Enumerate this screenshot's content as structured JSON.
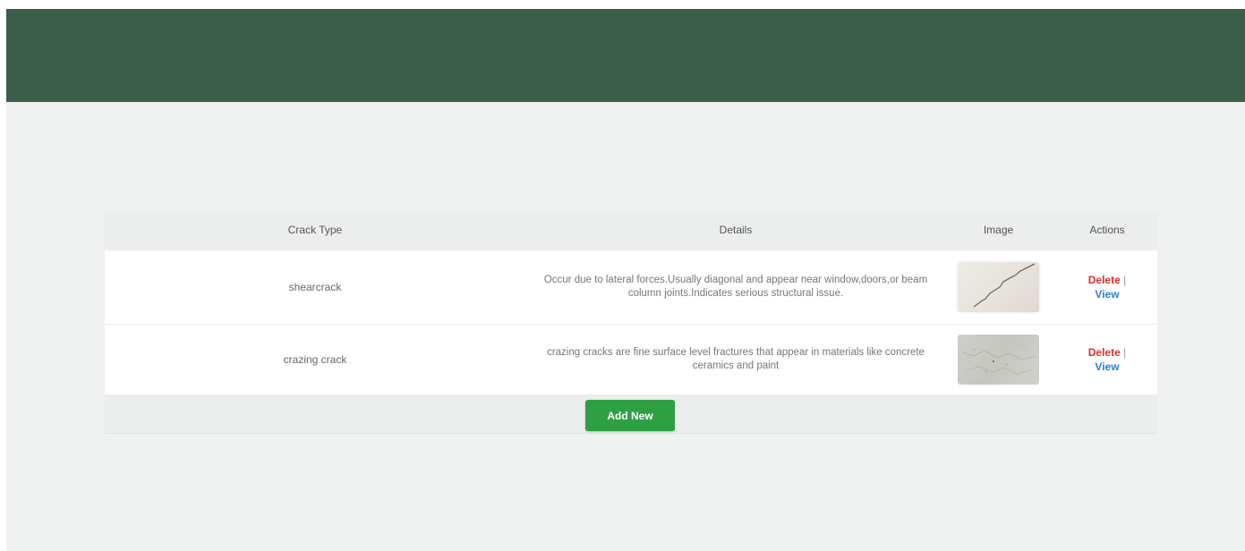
{
  "table": {
    "headers": {
      "crack_type": "Crack Type",
      "details": "Details",
      "image": "Image",
      "actions": "Actions"
    },
    "rows": [
      {
        "crack_type": "shearcrack",
        "details": "Occur due to lateral forces.Usually diagonal and appear near window,doors,or beam column joints.Indicates serious structural issue.",
        "image_icon": "shear-crack-photo",
        "delete_label": "Delete",
        "separator": "|",
        "view_label": "View"
      },
      {
        "crack_type": "crazing crack",
        "details": "crazing cracks are fine surface level fractures that appear in materials like concrete ceramics and paint",
        "image_icon": "crazing-crack-photo",
        "delete_label": "Delete",
        "separator": "|",
        "view_label": "View"
      }
    ]
  },
  "add_button": {
    "label": "Add New"
  },
  "colors": {
    "header_bg": "#3c5e4d",
    "page_bg": "#eff1f1",
    "delete": "#d9302b",
    "view": "#2a7fd4",
    "add_button": "#2ea043"
  }
}
